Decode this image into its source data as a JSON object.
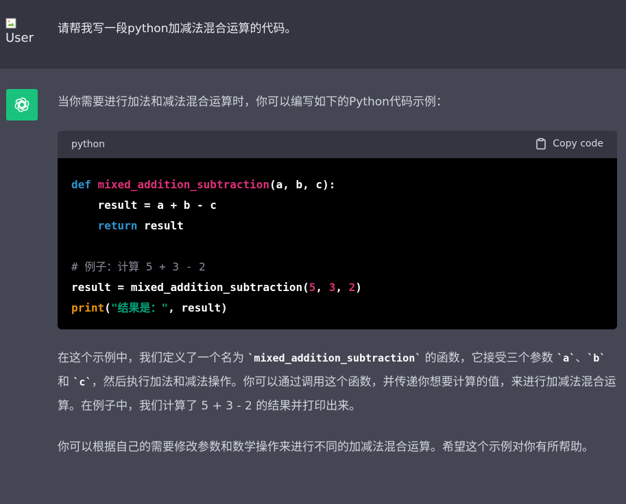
{
  "user": {
    "avatar_alt": "User",
    "message": "请帮我写一段python加减法混合运算的代码。"
  },
  "assistant": {
    "intro": "当你需要进行加法和减法混合运算时，你可以编写如下的Python代码示例：",
    "code_block": {
      "language": "python",
      "copy_label": "Copy code",
      "tokens": {
        "def": "def",
        "func_name": "mixed_addition_subtraction",
        "params": "(a, b, c):",
        "line2": "    result = a + b - c",
        "ret_indent": "    ",
        "return": "return",
        "ret_val": " result",
        "comment": "# 例子：计算 5 + 3 - 2",
        "line5_a": "result = mixed_addition_subtraction(",
        "n5": "5",
        "sep1": ", ",
        "n3": "3",
        "sep2": ", ",
        "n2": "2",
        "close": ")",
        "print": "print",
        "paren_open": "(",
        "str": "\"结果是：\"",
        "print_tail": ", result)"
      }
    },
    "para1": {
      "t1": "在这个示例中，我们定义了一个名为 ",
      "c1": "`mixed_addition_subtraction`",
      "t2": " 的函数，它接受三个参数 ",
      "c2": "`a`",
      "t3": "、",
      "c3": "`b`",
      "t4": " 和 ",
      "c4": "`c`",
      "t5": "，然后执行加法和减法操作。你可以通过调用这个函数，并传递你想要计算的值，来进行加减法混合运算。在例子中，我们计算了 5 + 3 - 2 的结果并打印出来。"
    },
    "para2": "你可以根据自己的需要修改参数和数学操作来进行不同的加减法混合运算。希望这个示例对你有所帮助。"
  },
  "colors": {
    "user_bg": "#343541",
    "assistant_bg": "#444654",
    "brand_green": "#19c37d",
    "keyword": "#2e95d3",
    "function": "#df3079",
    "builtin": "#e9950c",
    "string": "#00a67d"
  },
  "icons": {
    "assistant_avatar": "openai-logo-icon",
    "copy": "clipboard-icon",
    "user_avatar": "broken-image-icon"
  }
}
